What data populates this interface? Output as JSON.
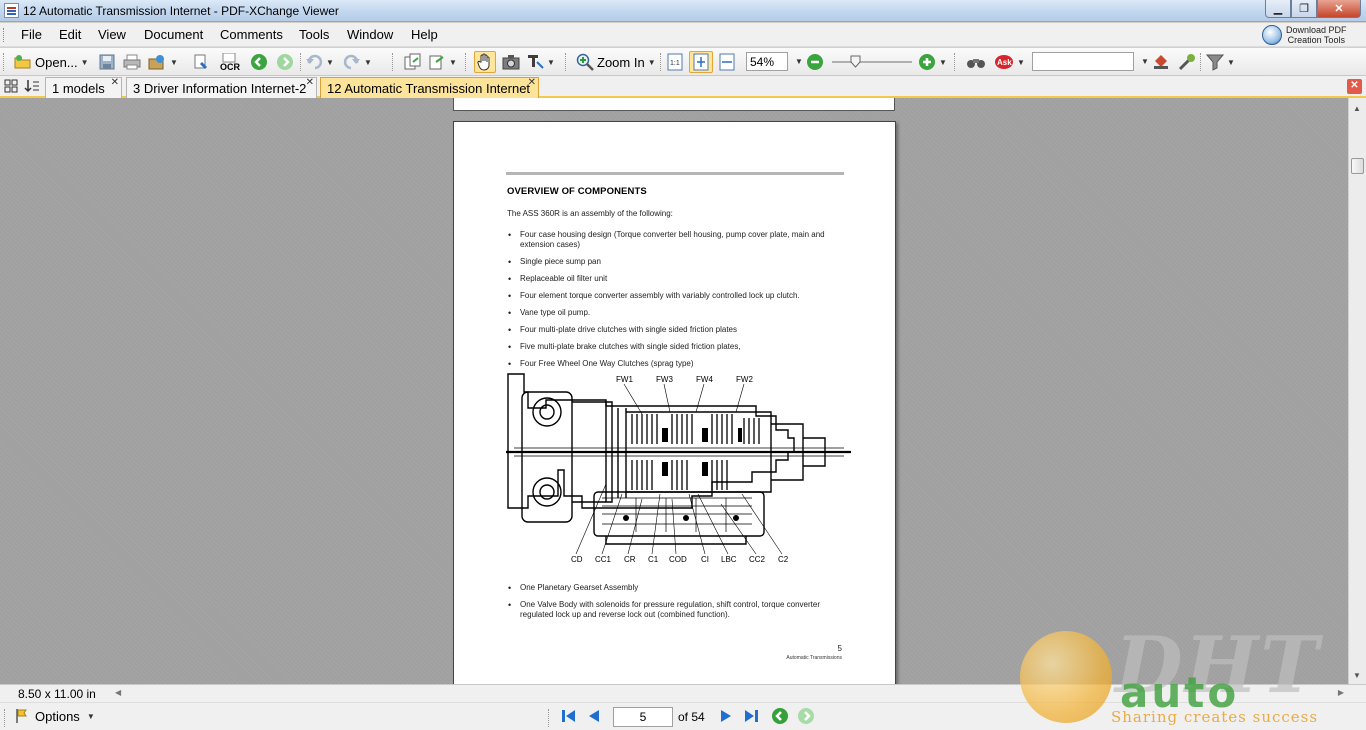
{
  "window": {
    "title": "12 Automatic Transmission Internet - PDF-XChange Viewer",
    "minimize": "▁",
    "maximize": "❐",
    "close": "✕"
  },
  "menu": {
    "items": [
      "File",
      "Edit",
      "View",
      "Document",
      "Comments",
      "Tools",
      "Window",
      "Help"
    ],
    "download_line1": "Download PDF",
    "download_line2": "Creation Tools"
  },
  "toolbar": {
    "open_label": "Open...",
    "ocr_label": "OCR",
    "zoom_in_label": "Zoom In",
    "zoom_value": "54%",
    "search_value": ""
  },
  "tabs": [
    {
      "label": "1 models",
      "active": false
    },
    {
      "label": "3 Driver Information Internet-2",
      "active": false
    },
    {
      "label": "12 Automatic Transmission Internet",
      "active": true
    }
  ],
  "document": {
    "heading": "OVERVIEW OF COMPONENTS",
    "intro": "The ASS 360R is an assembly of the following:",
    "bullets_top": [
      {
        "line1": "Four case housing design (Torque converter bell housing, pump cover plate, main and",
        "line2": "extension cases)"
      },
      {
        "line1": "Single piece sump pan",
        "line2": ""
      },
      {
        "line1": "Replaceable oil filter unit",
        "line2": ""
      },
      {
        "line1": "Four element torque converter assembly with variably controlled lock up clutch.",
        "line2": ""
      },
      {
        "line1": "Vane type oil pump.",
        "line2": ""
      },
      {
        "line1": "Four multi-plate drive clutches with single sided friction plates",
        "line2": ""
      },
      {
        "line1": "Five multi-plate brake clutches with single sided friction plates,",
        "line2": ""
      },
      {
        "line1": "Four Free Wheel One Way Clutches (sprag type)",
        "line2": ""
      }
    ],
    "diagram_labels_top": [
      "FW1",
      "FW3",
      "FW4",
      "FW2"
    ],
    "diagram_labels_bottom": [
      "CD",
      "CC1",
      "CR",
      "C1",
      "COD",
      "CI",
      "LBC",
      "CC2",
      "C2"
    ],
    "bullets_bottom": [
      {
        "line1": "One Planetary Gearset Assembly",
        "line2": ""
      },
      {
        "line1": "One Valve Body with solenoids for pressure regulation, shift control, torque converter",
        "line2": "regulated lock up and reverse lock out (combined function)."
      }
    ],
    "page_number": "5",
    "footer": "Automatic Transmissions"
  },
  "status": {
    "page_size": "8.50 x 11.00 in",
    "options_label": "Options",
    "current_page": "5",
    "total_pages": "of 54"
  },
  "watermark": {
    "brand": "DHT",
    "brand2": "auto",
    "tagline": "Sharing creates success"
  },
  "colors": {
    "active_tab": "#fbe39a",
    "doc_background": "#a0a0a0",
    "nav_blue": "#1f6fd1",
    "nav_green": "#36a03a"
  }
}
